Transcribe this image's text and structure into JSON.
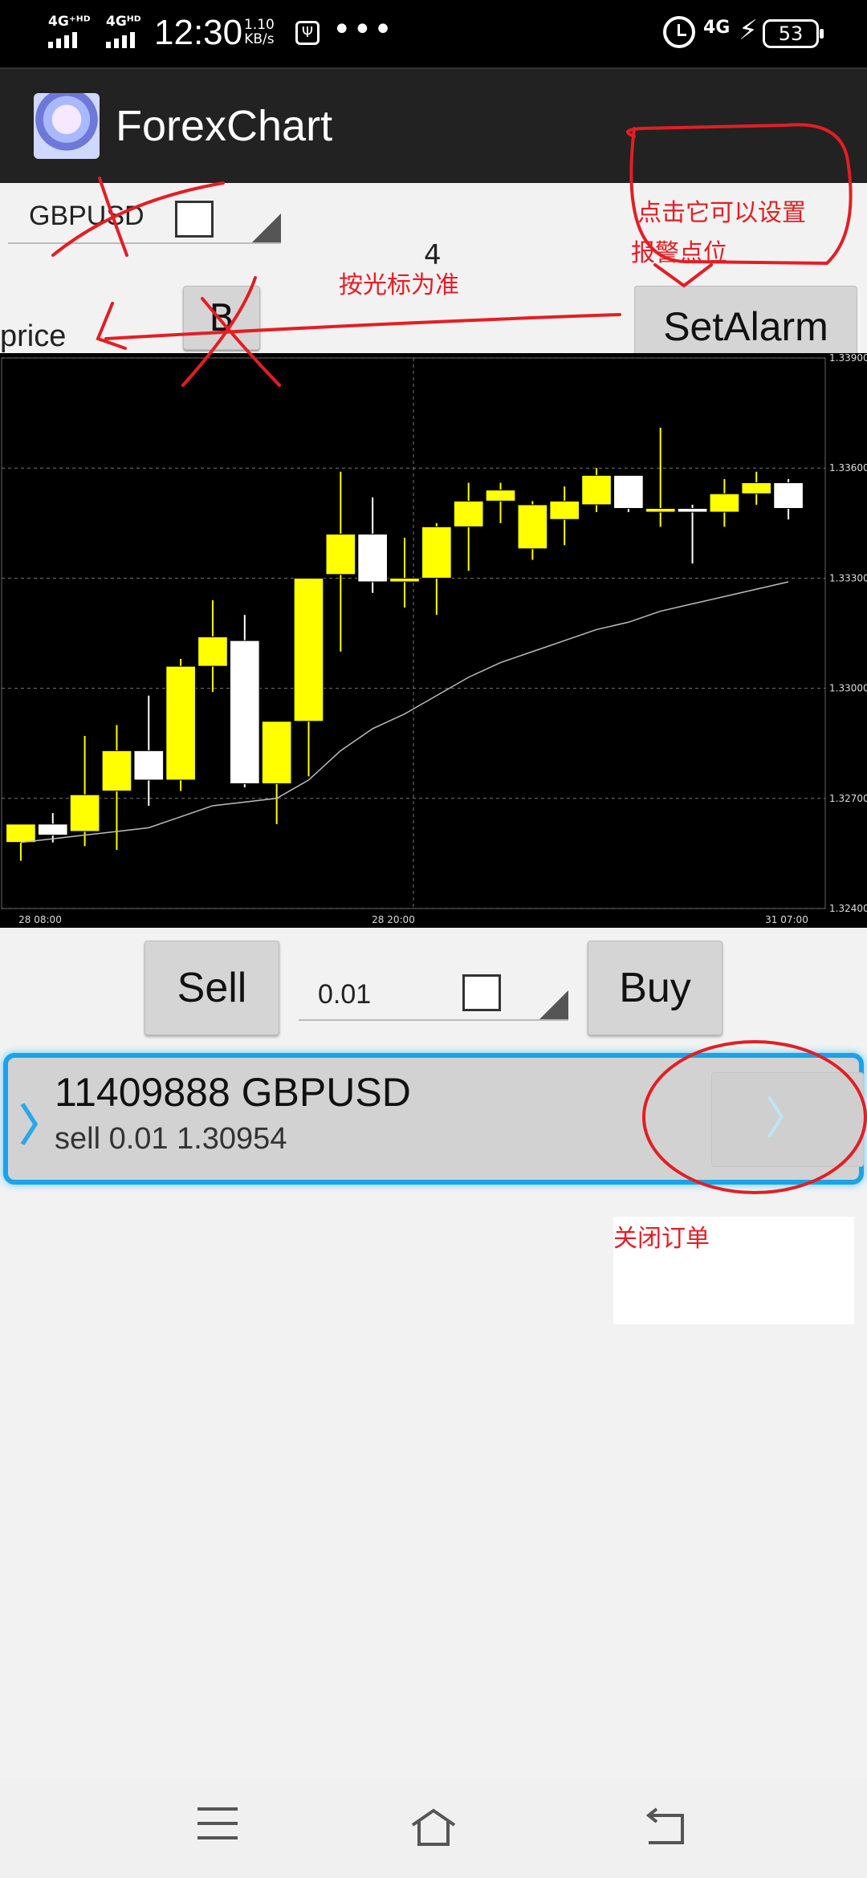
{
  "status_bar": {
    "net1": "4G⁺ᴴᴰ",
    "net2": "4Gᴴᴰ",
    "time": "12:30",
    "speed_value": "1.10",
    "speed_unit": "KB/s",
    "usb": "Ψ",
    "more": "•••",
    "net3": "4G",
    "battery": "53"
  },
  "app": {
    "title": "ForexChart"
  },
  "controls": {
    "symbol": "GBPUSD",
    "count": "4",
    "price_label": "price",
    "b_button": "B",
    "setalarm_button": "SetAlarm"
  },
  "chart_data": {
    "type": "candlestick",
    "x_ticks": [
      "28 08:00",
      "28 20:00",
      "31 07:00"
    ],
    "y_ticks": [
      "1.33900",
      "1.33600",
      "1.33300",
      "1.33000",
      "1.32700",
      "1.32400"
    ],
    "ylim": [
      1.324,
      1.339
    ],
    "up_color": "#ffff00",
    "down_color": "#ffffff",
    "ma_color": "#bdbdbd",
    "candles": [
      {
        "open": 1.3258,
        "high": 1.3263,
        "low": 1.3253,
        "close": 1.3263
      },
      {
        "open": 1.3263,
        "high": 1.3266,
        "low": 1.3258,
        "close": 1.326
      },
      {
        "open": 1.3261,
        "high": 1.3287,
        "low": 1.3257,
        "close": 1.3271
      },
      {
        "open": 1.3272,
        "high": 1.329,
        "low": 1.3256,
        "close": 1.3283
      },
      {
        "open": 1.3283,
        "high": 1.3298,
        "low": 1.3268,
        "close": 1.3275
      },
      {
        "open": 1.3275,
        "high": 1.3308,
        "low": 1.3272,
        "close": 1.3306
      },
      {
        "open": 1.3306,
        "high": 1.3324,
        "low": 1.3299,
        "close": 1.3314
      },
      {
        "open": 1.3313,
        "high": 1.332,
        "low": 1.3273,
        "close": 1.3274
      },
      {
        "open": 1.3274,
        "high": 1.3291,
        "low": 1.3263,
        "close": 1.3291
      },
      {
        "open": 1.3291,
        "high": 1.333,
        "low": 1.3276,
        "close": 1.333
      },
      {
        "open": 1.3331,
        "high": 1.3359,
        "low": 1.331,
        "close": 1.3342
      },
      {
        "open": 1.3342,
        "high": 1.3352,
        "low": 1.3326,
        "close": 1.3329
      },
      {
        "open": 1.3329,
        "high": 1.3341,
        "low": 1.3322,
        "close": 1.333
      },
      {
        "open": 1.333,
        "high": 1.3345,
        "low": 1.332,
        "close": 1.3344
      },
      {
        "open": 1.3344,
        "high": 1.3356,
        "low": 1.3332,
        "close": 1.3351
      },
      {
        "open": 1.3351,
        "high": 1.3356,
        "low": 1.3345,
        "close": 1.3354
      },
      {
        "open": 1.3338,
        "high": 1.3351,
        "low": 1.3335,
        "close": 1.335
      },
      {
        "open": 1.3346,
        "high": 1.3355,
        "low": 1.3339,
        "close": 1.3351
      },
      {
        "open": 1.335,
        "high": 1.336,
        "low": 1.3348,
        "close": 1.3358
      },
      {
        "open": 1.3358,
        "high": 1.3358,
        "low": 1.3348,
        "close": 1.3349
      },
      {
        "open": 1.3348,
        "high": 1.3371,
        "low": 1.3344,
        "close": 1.3349
      },
      {
        "open": 1.3349,
        "high": 1.335,
        "low": 1.3334,
        "close": 1.3348
      },
      {
        "open": 1.3348,
        "high": 1.3357,
        "low": 1.3344,
        "close": 1.3353
      },
      {
        "open": 1.3353,
        "high": 1.3359,
        "low": 1.335,
        "close": 1.3356
      },
      {
        "open": 1.3356,
        "high": 1.3357,
        "low": 1.3346,
        "close": 1.3349
      }
    ],
    "ma": [
      1.3258,
      1.3259,
      1.326,
      1.3261,
      1.3262,
      1.3265,
      1.3268,
      1.3269,
      1.327,
      1.3275,
      1.3283,
      1.3289,
      1.3293,
      1.3298,
      1.3303,
      1.3307,
      1.331,
      1.3313,
      1.3316,
      1.3318,
      1.3321,
      1.3323,
      1.3325,
      1.3327,
      1.3329
    ]
  },
  "order": {
    "sell": "Sell",
    "lot": "0.01",
    "buy": "Buy"
  },
  "position": {
    "title": "11409888 GBPUSD",
    "detail": "sell 0.01 1.30954",
    "close_arrow": "〉",
    "expand_arrow": "〉"
  },
  "annotations": {
    "alarm_note_line1": "点击它可以设置",
    "alarm_note_line2": "报警点位",
    "cursor_note": "按光标为准",
    "close_note": "关闭订单"
  },
  "nav": {
    "menu": "menu",
    "home": "home",
    "back": "back"
  }
}
